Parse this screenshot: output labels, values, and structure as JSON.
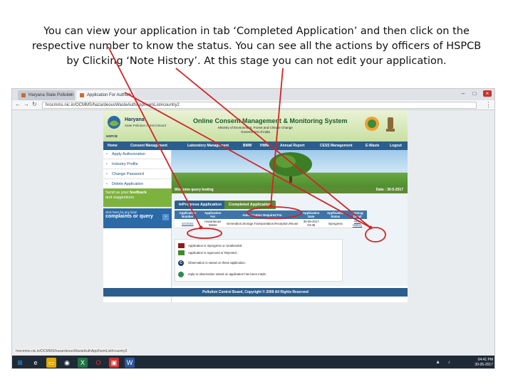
{
  "caption": {
    "line1": "You can view your application in tab ‘Completed Application’ and then click on the",
    "line2": "respective number to know the status. You can see all the actions by officers of HSPCB",
    "line3": "by Clicking ‘Note History’. At this stage you can not edit your application."
  },
  "browser": {
    "tabs": [
      {
        "label": "Haryana State Pollution"
      },
      {
        "label": "Application For Authori"
      }
    ],
    "url": "hrocmms.nic.in/OCMMS/hazardeousWasteAuthApp/hwmList#country2",
    "status_url": "hrocmms.nic.in/OCMMS/hazardeousWasteAuthApp/hwmList#country2"
  },
  "site": {
    "org_name": "Haryana",
    "org_sub": "State Pollution Control Board",
    "logo_text": "HSPCB",
    "title": "Online Consent Management & Monitoring System",
    "ministry_line1": "Ministry of Environment, Forest and Climate Change",
    "ministry_line2": "Government of India",
    "nav": [
      "Home",
      "Consent Management",
      "Laboratory Management",
      "BMW",
      "HWM",
      "Annual Report",
      "CESS Management",
      "E-Waste",
      "Logout"
    ],
    "sidebar": [
      "Apply Authorization",
      "Industry Profile",
      "Change Password",
      "Delete Application"
    ],
    "feedback_prefix": "Send us your ",
    "feedback_bold": "feedback",
    "feedback_line2": "and suggestions",
    "complaints_small": "click here for any kind",
    "complaints_big": "complaints or query",
    "welcome": "Welcome query testing",
    "date": "Date : 30-5-2017",
    "content_tabs": [
      "InProgress Application",
      "Completed Application"
    ],
    "table": {
      "headers": [
        "Application Number",
        "Application For",
        "Authorization Required For",
        "Application Date",
        "Application Status",
        "Noteing Detail"
      ],
      "row": [
        "4210151",
        "Hazardeous Waste",
        "Generation,Storage,Transportation,Reception,Reuse",
        "30-05-2017 04:35",
        "Inprogress",
        "Note History"
      ]
    },
    "legend": [
      {
        "text": "Application is Inprogress or Unattended .",
        "color": "#8b1c1c"
      },
      {
        "text": "Application is Approved or Rejected .",
        "color": "#3f8a2f"
      },
      {
        "text": "Observation is raised on these application.",
        "color": "#1d3f66",
        "glyph": "C"
      },
      {
        "text": "reply to observation raised on application has been made .",
        "color": "#2f8a55",
        "glyph": ""
      }
    ],
    "footer": "Pollution Control Board, Copyright © 2009 All Rights Reserved"
  },
  "taskbar": {
    "time": "04:41 PM",
    "date": "30-05-2017"
  },
  "colors": {
    "annotation_red": "#d42323",
    "nav_blue": "#2b5e8c",
    "accent_green": "#5d8a35"
  }
}
